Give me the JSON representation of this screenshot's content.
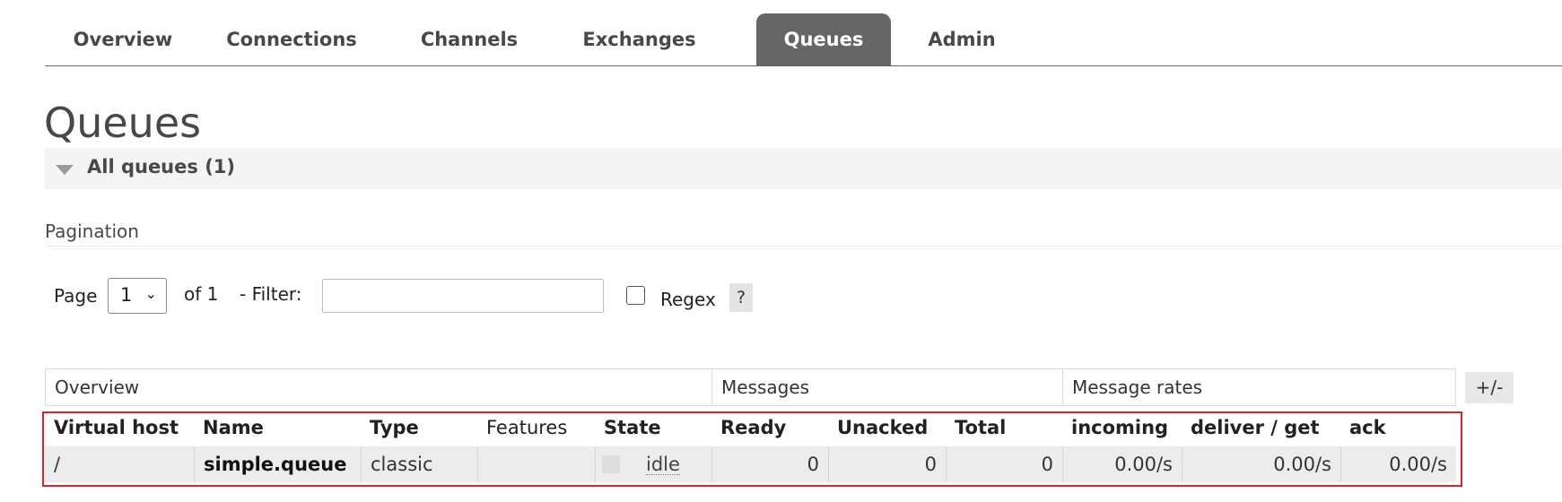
{
  "nav": {
    "tabs": [
      {
        "label": "Overview",
        "active": false
      },
      {
        "label": "Connections",
        "active": false
      },
      {
        "label": "Channels",
        "active": false
      },
      {
        "label": "Exchanges",
        "active": false
      },
      {
        "label": "Queues",
        "active": true
      },
      {
        "label": "Admin",
        "active": false
      }
    ]
  },
  "page": {
    "title": "Queues",
    "section_title": "All queues (1)"
  },
  "pagination": {
    "label": "Pagination",
    "page_label": "Page",
    "page_value": "1",
    "of_label": "of 1",
    "filter_label": "- Filter:",
    "filter_value": "",
    "regex_label": "Regex",
    "regex_checked": false,
    "help_label": "?"
  },
  "table": {
    "groups": [
      "Overview",
      "Messages",
      "Message rates"
    ],
    "toggle_columns_label": "+/-",
    "columns": [
      "Virtual host",
      "Name",
      "Type",
      "Features",
      "State",
      "Ready",
      "Unacked",
      "Total",
      "incoming",
      "deliver / get",
      "ack"
    ],
    "rows": [
      {
        "vhost": "/",
        "name": "simple.queue",
        "type": "classic",
        "features": "",
        "state": "idle",
        "ready": "0",
        "unacked": "0",
        "total": "0",
        "incoming": "0.00/s",
        "deliver_get": "0.00/s",
        "ack": "0.00/s"
      }
    ]
  },
  "colors": {
    "active_tab": "#666666",
    "highlight_border": "#d9232a",
    "row_background": "#ececec"
  }
}
